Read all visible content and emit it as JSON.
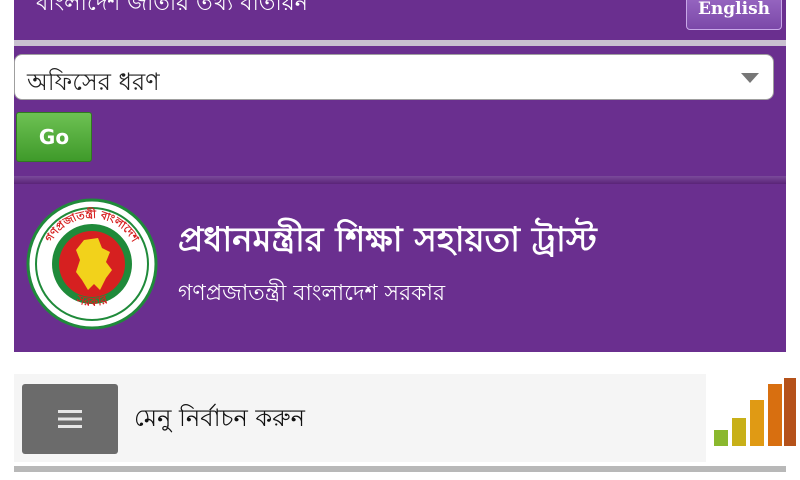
{
  "top_bar": {
    "text": "বাংলাদেশ জাতীয় তথ্য বাতায়ন",
    "language_button": "English"
  },
  "search": {
    "office_type_selected": "অফিসের ধরণ",
    "go_label": "Go"
  },
  "header": {
    "title": "প্রধানমন্ত্রীর শিক্ষা সহায়তা ট্রাস্ট",
    "subtitle": "গণপ্রজাতন্ত্রী বাংলাদেশ সরকার",
    "logo": {
      "ring_top_text": "গণপ্রজাতন্ত্রী বাংলাদেশ",
      "ring_bottom_text": "সরকার"
    }
  },
  "menu": {
    "icon": "hamburger-icon",
    "label": "মেনু নির্বাচন করুন"
  },
  "signal_icon": {
    "colors": [
      "#8ab82e",
      "#c8b018",
      "#e09a14",
      "#d86f10",
      "#b5521a"
    ]
  },
  "colors": {
    "brand_purple": "#6a2f8f",
    "go_green": "#4caf35"
  }
}
